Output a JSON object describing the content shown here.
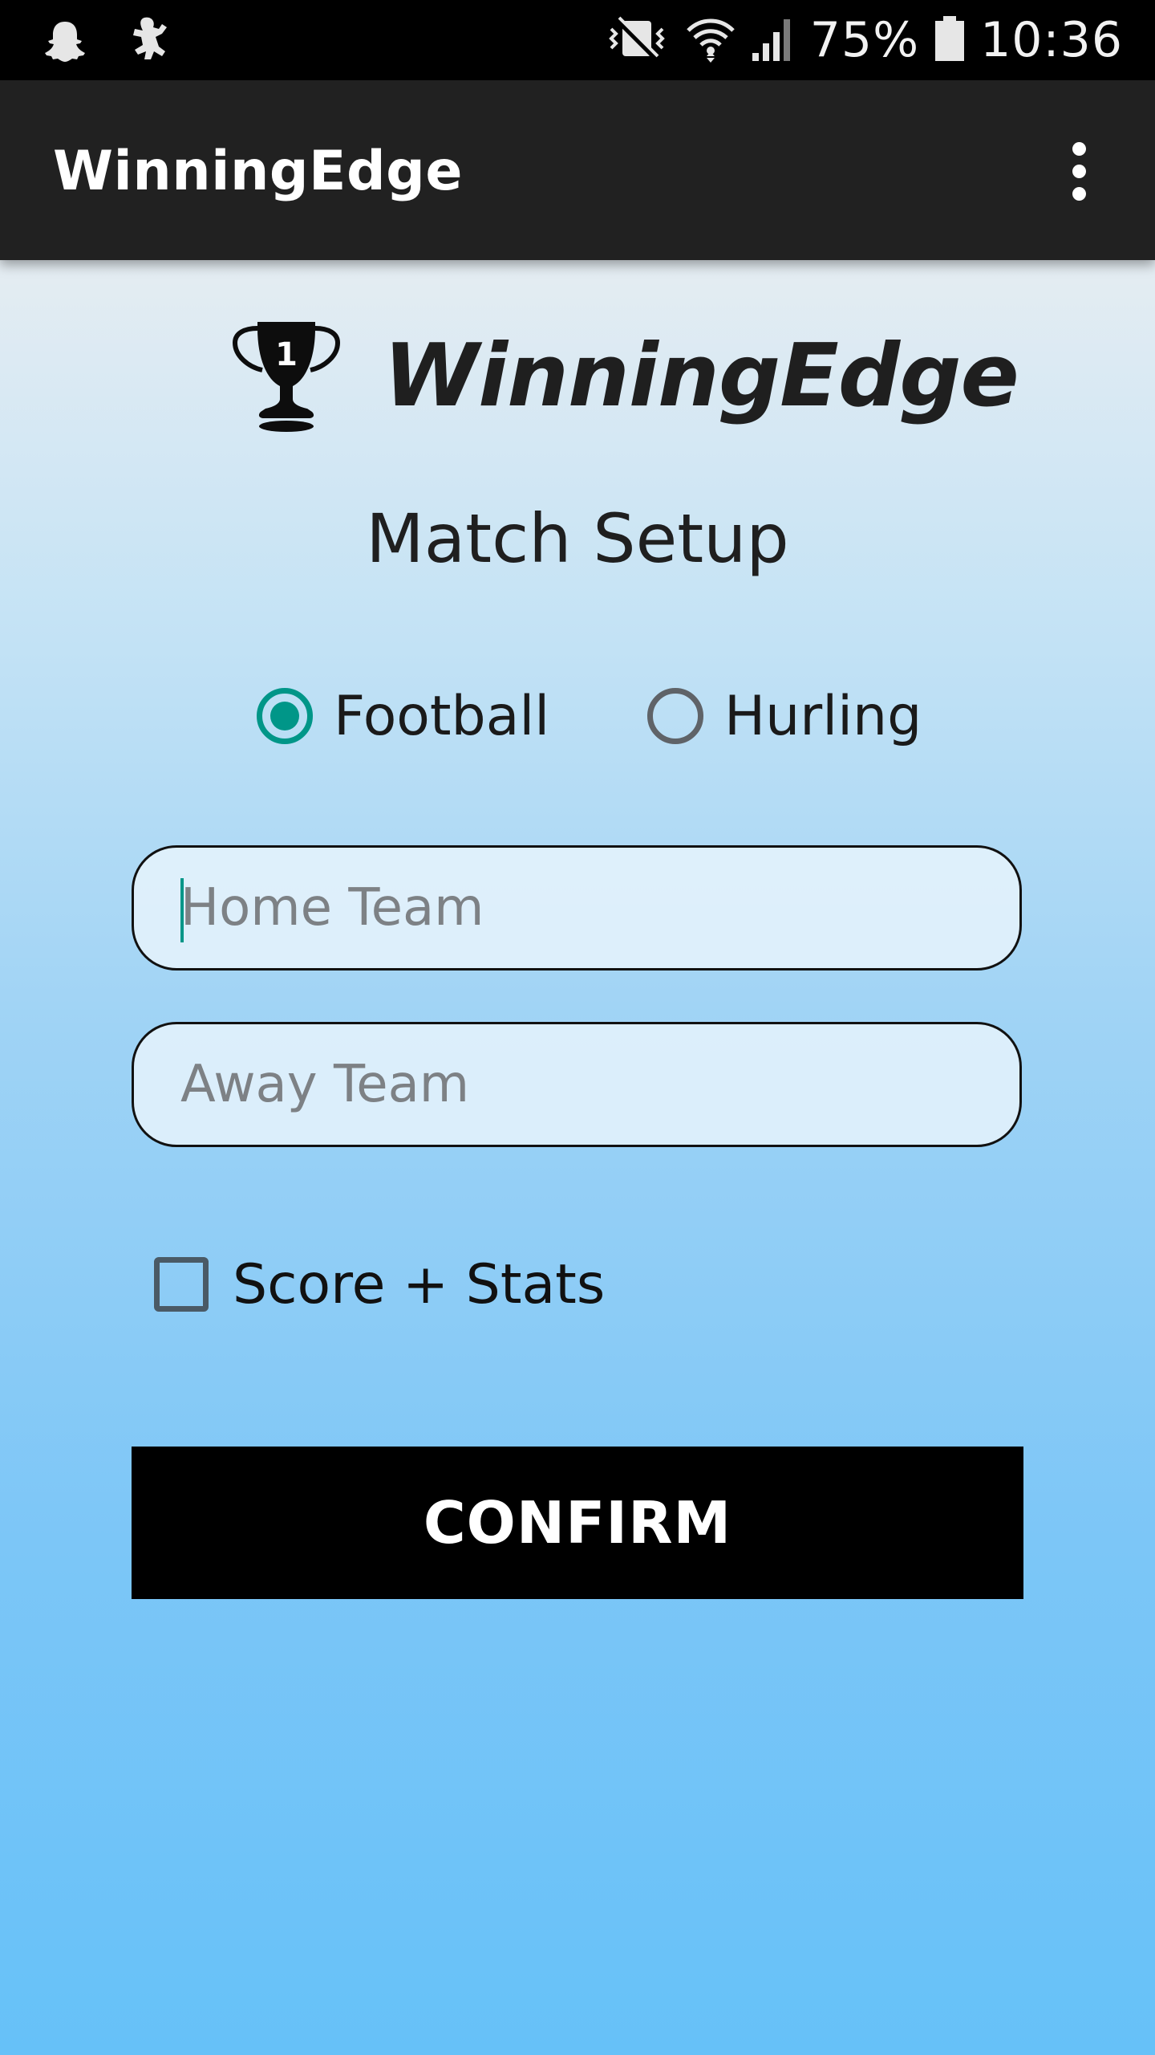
{
  "status_bar": {
    "battery_percent": "75%",
    "time": "10:36",
    "left_icons": [
      "snapchat-icon",
      "notification-app-icon"
    ],
    "right_icons": [
      "vibrate-icon",
      "wifi-icon",
      "signal-icon",
      "battery-icon"
    ]
  },
  "app_bar": {
    "title": "WinningEdge",
    "overflow_icon": "more-vert-icon"
  },
  "logo": {
    "icon": "trophy-icon",
    "trophy_number": "1",
    "brand_name": "WinningEdge"
  },
  "page_heading": "Match Setup",
  "sport_options": [
    {
      "label": "Football",
      "selected": true
    },
    {
      "label": "Hurling",
      "selected": false
    }
  ],
  "home_team": {
    "value": "",
    "placeholder": "Home Team"
  },
  "away_team": {
    "value": "",
    "placeholder": "Away Team"
  },
  "score_stats": {
    "label": "Score + Stats",
    "checked": false
  },
  "confirm_label": "CONFIRM",
  "colors": {
    "accent": "#009688",
    "app_bar": "#212121",
    "status_bar": "#000000",
    "button": "#000000"
  }
}
